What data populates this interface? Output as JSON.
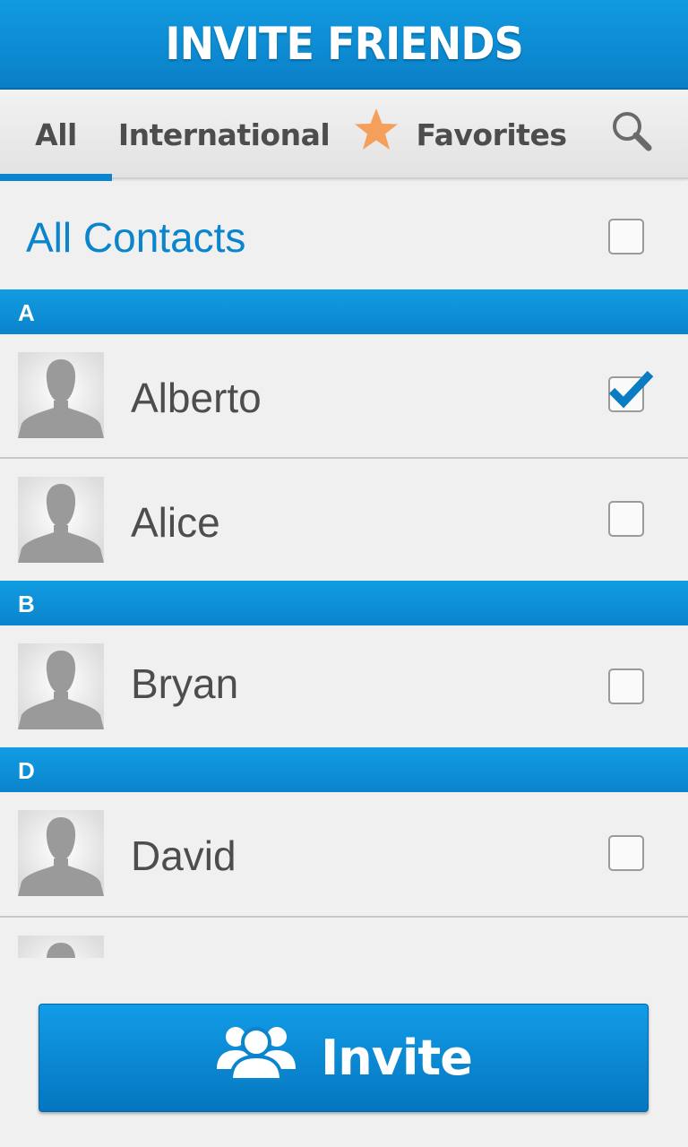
{
  "header": {
    "title": "INVITE FRIENDS"
  },
  "tabs": {
    "all": "All",
    "international": "International",
    "favorites": "Favorites"
  },
  "all_contacts": {
    "label": "All Contacts",
    "checked": false
  },
  "sections": [
    {
      "letter": "A"
    },
    {
      "letter": "B"
    },
    {
      "letter": "D"
    }
  ],
  "contacts": [
    {
      "name": "Alberto",
      "checked": true
    },
    {
      "name": "Alice",
      "checked": false
    },
    {
      "name": "Bryan",
      "checked": false
    },
    {
      "name": "David",
      "checked": false
    }
  ],
  "invite_button": {
    "label": "Invite"
  },
  "colors": {
    "accent": "#0a84cc",
    "star": "#f4a05a",
    "avatar_silhouette": "#9a9a9a"
  },
  "icons": [
    "star-icon",
    "search-icon",
    "avatar-placeholder-icon",
    "checkmark-icon",
    "group-icon"
  ]
}
